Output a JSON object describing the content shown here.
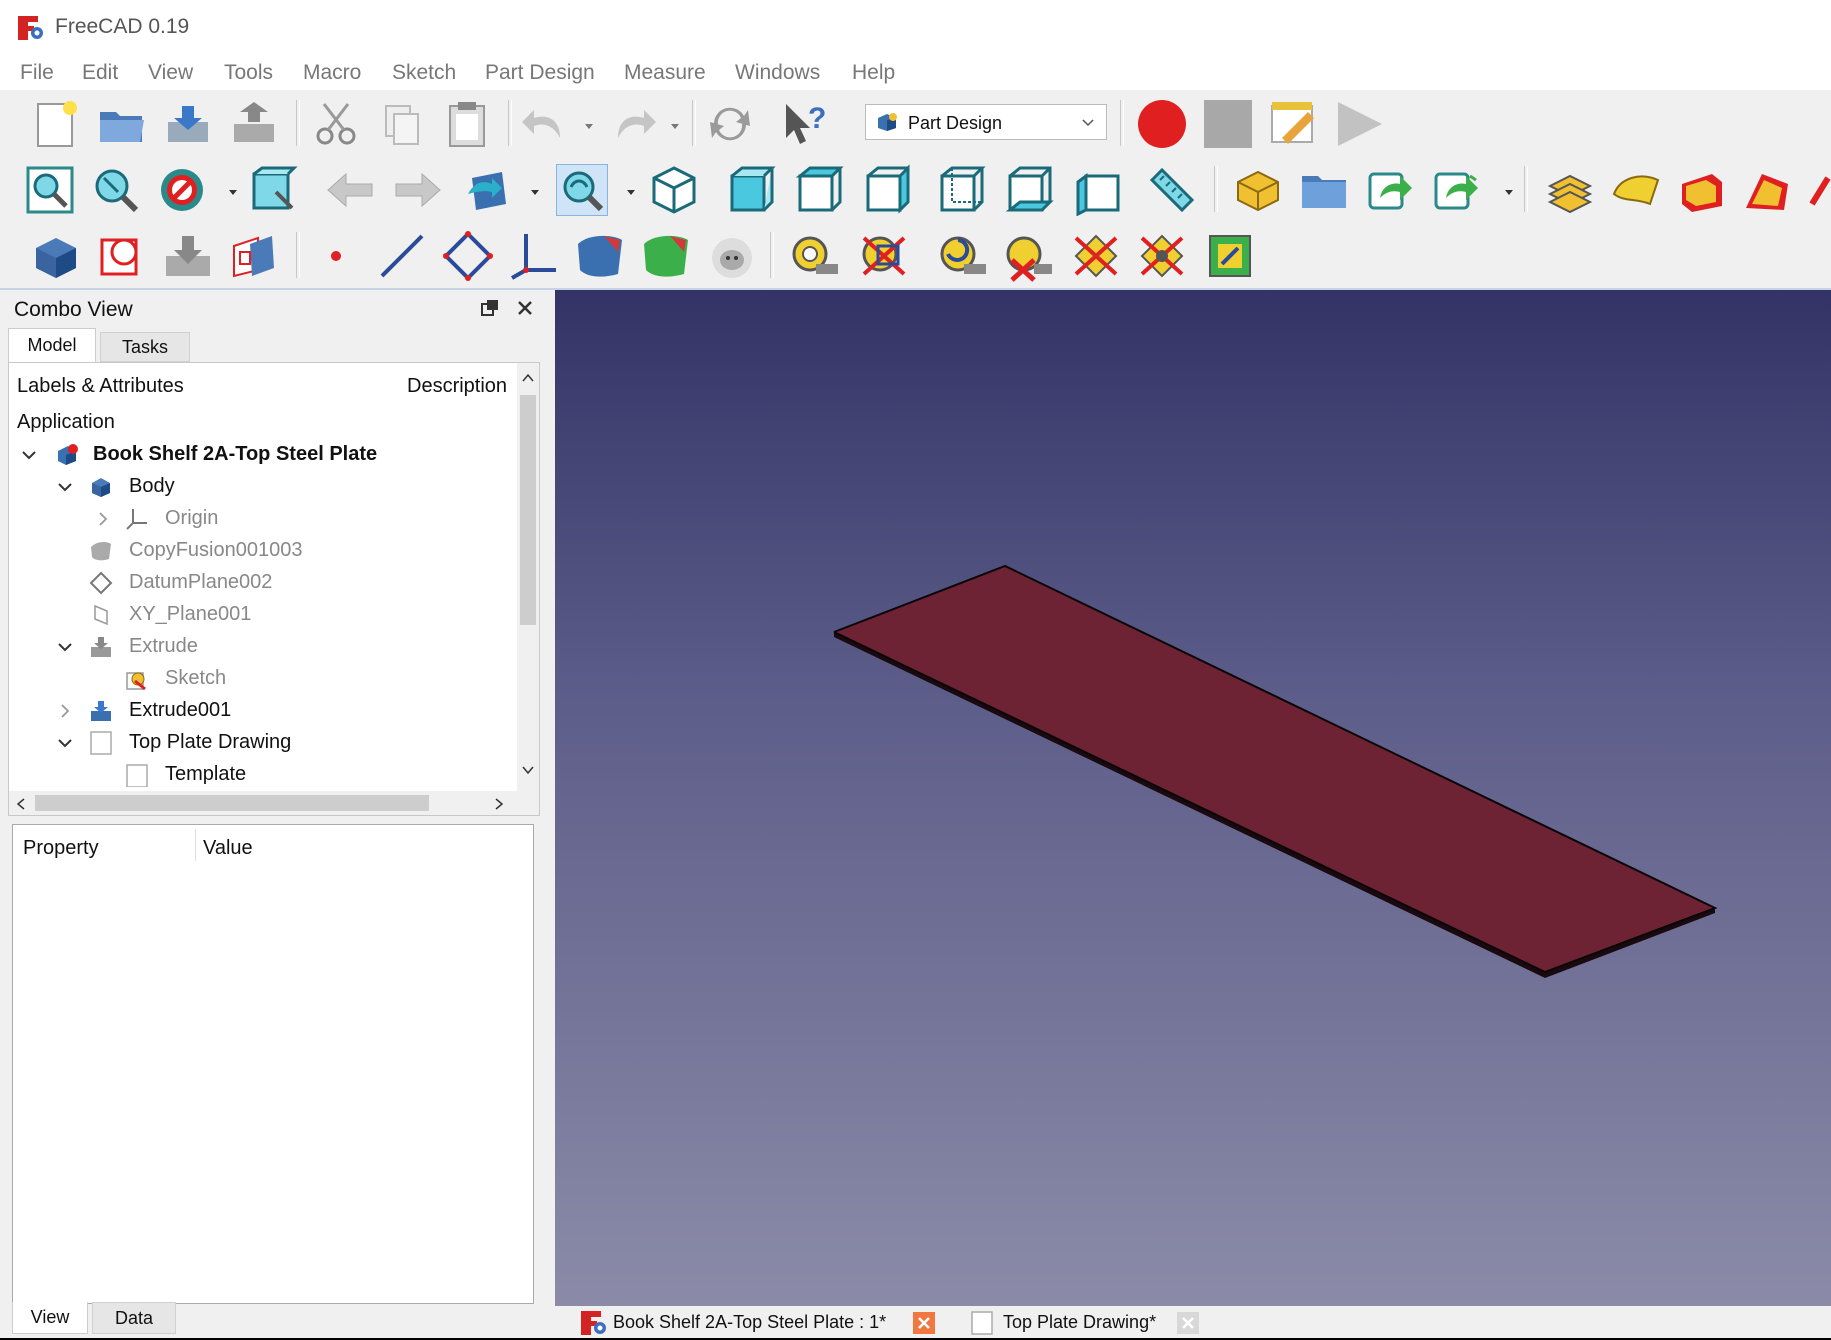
{
  "window": {
    "title": "FreeCAD 0.19"
  },
  "menu": [
    "File",
    "Edit",
    "View",
    "Tools",
    "Macro",
    "Sketch",
    "Part Design",
    "Measure",
    "Windows",
    "Help"
  ],
  "workbench": {
    "selected": "Part Design"
  },
  "combo_view": {
    "title": "Combo View",
    "tabs": [
      "Model",
      "Tasks"
    ],
    "tree": {
      "columns": [
        "Labels & Attributes",
        "Description"
      ],
      "items": [
        {
          "label": "Application"
        },
        {
          "label": "Book Shelf 2A-Top Steel Plate"
        },
        {
          "label": "Body"
        },
        {
          "label": "Origin"
        },
        {
          "label": "CopyFusion001003"
        },
        {
          "label": "DatumPlane002"
        },
        {
          "label": "XY_Plane001"
        },
        {
          "label": "Extrude"
        },
        {
          "label": "Sketch"
        },
        {
          "label": "Extrude001"
        },
        {
          "label": "Top Plate Drawing"
        },
        {
          "label": "Template"
        }
      ]
    },
    "property_columns": [
      "Property",
      "Value"
    ],
    "bottom_tabs": [
      "View",
      "Data"
    ]
  },
  "document_tabs": [
    {
      "label": "Book Shelf 2A-Top Steel Plate : 1*"
    },
    {
      "label": "Top Plate Drawing*"
    }
  ],
  "colors": {
    "plate": "#6e2335",
    "viewport_top": "#333366",
    "viewport_bottom": "#8b8ba8",
    "accent_red": "#e02020"
  }
}
